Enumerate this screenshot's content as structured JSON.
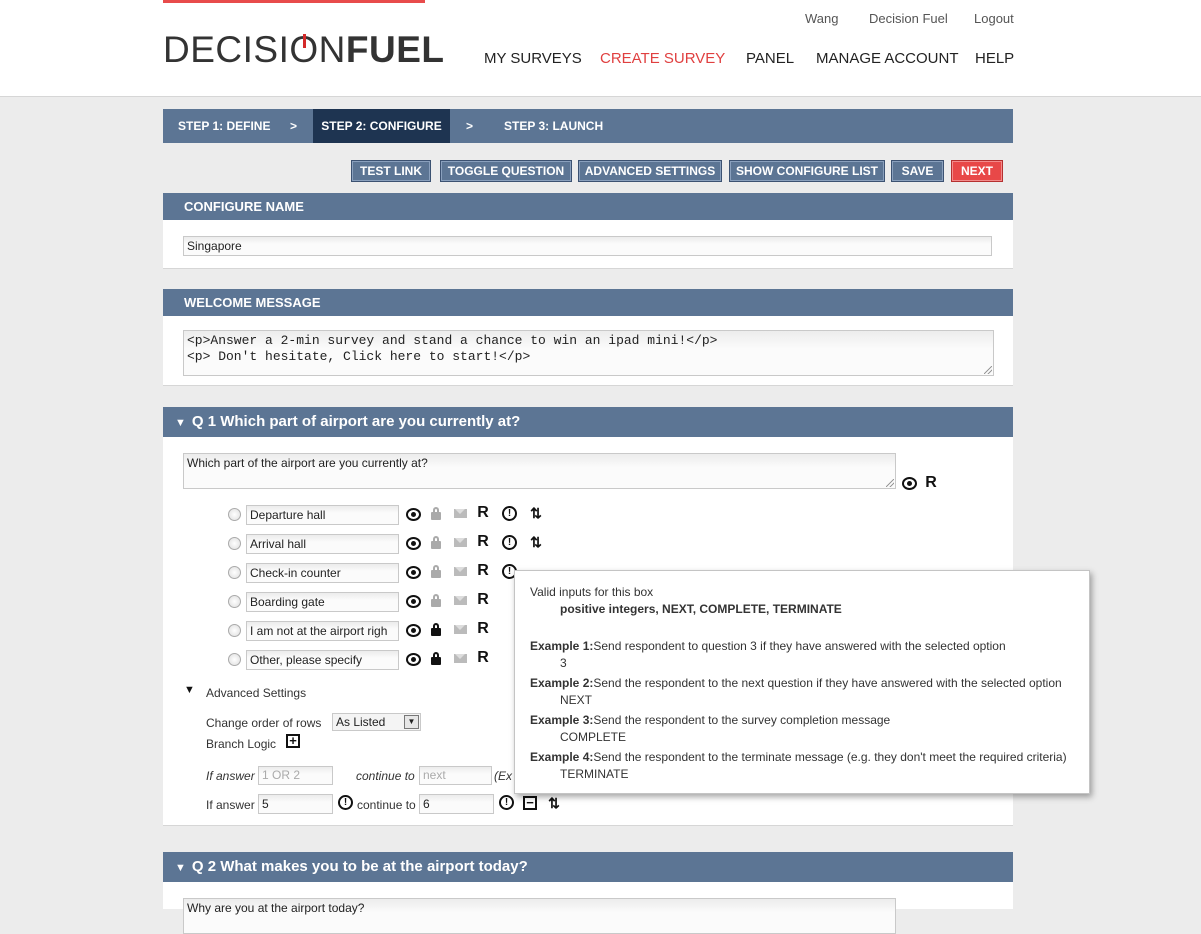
{
  "header": {
    "logo": {
      "part1": "DECISI",
      "o": "O",
      "part2": "N",
      "part3": "FUEL"
    },
    "top_links": {
      "user": "Wang",
      "org": "Decision Fuel",
      "logout": "Logout"
    },
    "nav": {
      "my_surveys": "MY SURVEYS",
      "create_survey": "CREATE SURVEY",
      "panel": "PANEL",
      "manage_account": "MANAGE ACCOUNT",
      "help": "HELP"
    }
  },
  "steps": {
    "step1": "STEP 1: DEFINE",
    "sep": ">",
    "step2": "STEP 2: CONFIGURE",
    "step3": "STEP 3: LAUNCH"
  },
  "toolbar": {
    "test_link": "TEST LINK",
    "toggle_question": "TOGGLE QUESTION",
    "advanced_settings": "ADVANCED SETTINGS",
    "show_configure_list": "SHOW CONFIGURE LIST",
    "save": "SAVE",
    "next": "NEXT"
  },
  "configure_name": {
    "title": "CONFIGURE NAME",
    "value": "Singapore"
  },
  "welcome_message": {
    "title": "WELCOME MESSAGE",
    "value": "<p>Answer a 2-min survey and stand a chance to win an ipad mini!</p>\n<p> Don't hesitate, Click here to start!</p>"
  },
  "q1": {
    "tri": "▼",
    "title": "Q 1  Which part of airport are you currently at?",
    "text": "Which part of the airport are you currently at?",
    "options": [
      "Departure hall",
      "Arrival hall",
      "Check-in counter",
      "Boarding gate",
      "I am not at the airport righ",
      "Other, please specify"
    ],
    "icon_r": "R",
    "advanced_label": "Advanced Settings",
    "order_label": "Change order of rows",
    "order_value": "As Listed",
    "branch_label": "Branch Logic",
    "if_answer": "If answer",
    "continue_to": "continue to",
    "placeholder_answer": "1 OR 2",
    "placeholder_continue": "next",
    "ex_cut": "(Ex",
    "answer_value": "5",
    "continue_value": "6"
  },
  "q2": {
    "tri": "▼",
    "title": "Q 2  What makes you to be at the airport today?",
    "text": "Why are you at the airport today?"
  },
  "tooltip": {
    "title": "Valid inputs for this box",
    "valid": "positive integers, NEXT, COMPLETE, TERMINATE",
    "ex1_label": "Example 1:",
    "ex1_text": "Send respondent to question 3 if they have answered with the selected option",
    "ex1_value": "3",
    "ex2_label": "Example 2:",
    "ex2_text": "Send the respondent to the next question if they have answered with the selected option",
    "ex2_value": "NEXT",
    "ex3_label": "Example 3:",
    "ex3_text": "Send the respondent to the survey completion message",
    "ex3_value": "COMPLETE",
    "ex4_label": "Example 4:",
    "ex4_text": "Send the respondent to the terminate message (e.g. they don't meet the required criteria)",
    "ex4_value": "TERMINATE"
  },
  "colors": {
    "accent": "#e84848",
    "bar": "#5c7594",
    "bar_dark": "#1e3451"
  }
}
